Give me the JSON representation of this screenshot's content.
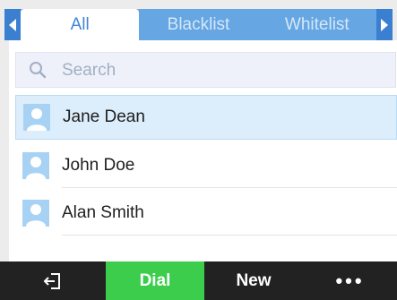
{
  "tabs": {
    "items": [
      {
        "label": "All",
        "active": true
      },
      {
        "label": "Blacklist",
        "active": false
      },
      {
        "label": "Whitelist",
        "active": false
      }
    ]
  },
  "search": {
    "placeholder": "Search"
  },
  "contacts": [
    {
      "name": "Jane Dean",
      "selected": true
    },
    {
      "name": "John Doe",
      "selected": false
    },
    {
      "name": "Alan Smith",
      "selected": false
    }
  ],
  "softkeys": {
    "back_icon": "exit-icon",
    "dial": "Dial",
    "new": "New",
    "more": "•••"
  },
  "colors": {
    "accent": "#3b7fd0",
    "tab_bar": "#65a6e3",
    "selected_row": "#dcedfb",
    "dial_key": "#3ccd4d",
    "softkey_bar": "#222222"
  }
}
